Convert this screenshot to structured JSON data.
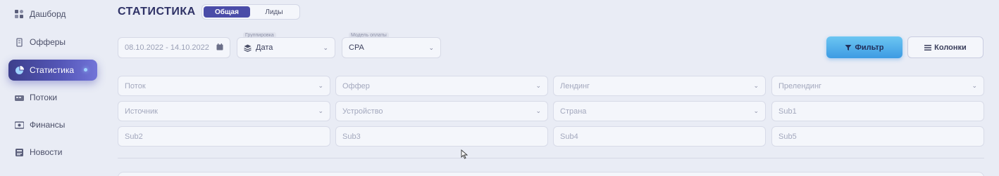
{
  "sidebar": {
    "items": [
      {
        "label": "Дашборд",
        "icon": "dashboard-icon"
      },
      {
        "label": "Офферы",
        "icon": "offers-icon"
      },
      {
        "label": "Статистика",
        "icon": "statistics-icon"
      },
      {
        "label": "Потоки",
        "icon": "streams-icon"
      },
      {
        "label": "Финансы",
        "icon": "finance-icon"
      },
      {
        "label": "Новости",
        "icon": "news-icon"
      }
    ],
    "active_index": 2
  },
  "header": {
    "title": "СТАТИСТИКА",
    "tabs": [
      "Общая",
      "Лиды"
    ],
    "active_tab": 0
  },
  "controls": {
    "date_range": "08.10.2022 - 14.10.2022",
    "grouping_label": "Группировка",
    "grouping_value": "Дата",
    "payment_label": "Модель оплаты",
    "payment_value": "CPA",
    "filter_button": "Фильтр",
    "columns_button": "Колонки"
  },
  "filters": {
    "row1": [
      "Поток",
      "Оффер",
      "Лендинг",
      "Прелендинг"
    ],
    "row2": [
      "Источник",
      "Устройство",
      "Страна",
      "Sub1"
    ],
    "row3": [
      "Sub2",
      "Sub3",
      "Sub4",
      "Sub5"
    ]
  },
  "colors": {
    "accent": "#4a4ca8",
    "filter_button": "#3d9be3",
    "background": "#e9ecf5"
  }
}
